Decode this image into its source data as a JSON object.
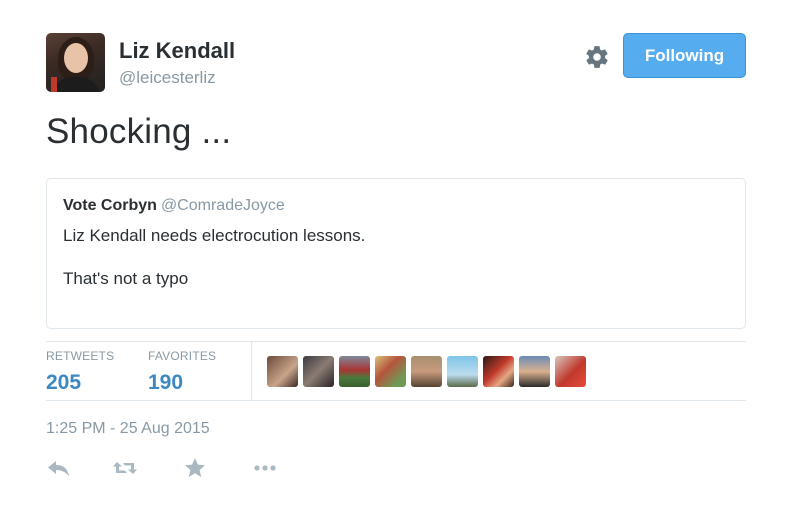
{
  "tweet": {
    "author_name": "Liz Kendall",
    "author_handle": "@leicesterliz",
    "follow_button_label": "Following",
    "text": "Shocking ...",
    "timestamp": "1:25 PM - 25 Aug 2015"
  },
  "quoted_tweet": {
    "author_name": "Vote Corbyn",
    "author_handle": "@ComradeJoyce",
    "line1": "Liz Kendall needs electrocution lessons.",
    "line2": "That's not a typo"
  },
  "stats": {
    "retweets_label": "RETWEETS",
    "retweets_count": "205",
    "favorites_label": "FAVORITES",
    "favorites_count": "190"
  },
  "icons": {
    "settings": "gear-icon",
    "reply": "reply-icon",
    "retweet": "retweet-icon",
    "favorite": "star-icon",
    "more": "more-icon"
  },
  "colors": {
    "follow_button": "#55acee",
    "stat_value": "#3b88c3",
    "muted_text": "#8899a6",
    "border": "#e1e8ed",
    "icon": "#aab8c2"
  }
}
